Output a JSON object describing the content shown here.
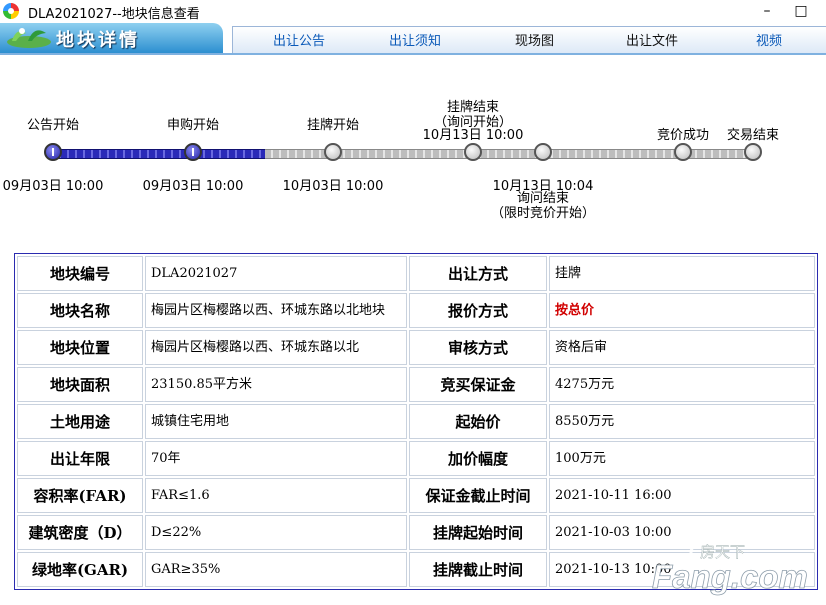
{
  "window": {
    "title": "DLA2021027--地块信息查看",
    "minimize": "–",
    "maximize": "□"
  },
  "logo": {
    "text": "地块详情"
  },
  "nav": [
    "出让公告",
    "出让须知",
    "现场图",
    "出让文件",
    "视频"
  ],
  "timeline": {
    "steps": [
      {
        "label": "公告开始",
        "time": "09月03日 10:00"
      },
      {
        "label": "申购开始",
        "time": "09月03日 10:00"
      },
      {
        "label": "挂牌开始",
        "time": "10月03日 10:00"
      },
      {
        "label": "挂牌结束",
        "sub": "（询问开始）",
        "time": "10月13日 10:00"
      },
      {
        "label": "询问结束",
        "sub": "（限时竞价开始）",
        "time": "10月13日 10:04"
      },
      {
        "label": "竞价成功"
      },
      {
        "label": "交易结束"
      }
    ]
  },
  "table": {
    "rows": [
      [
        "地块编号",
        "DLA2021027",
        "出让方式",
        "挂牌"
      ],
      [
        "地块名称",
        "梅园片区梅樱路以西、环城东路以北地块",
        "报价方式",
        "按总价"
      ],
      [
        "地块位置",
        "梅园片区梅樱路以西、环城东路以北",
        "审核方式",
        "资格后审"
      ],
      [
        "地块面积",
        "23150.85平方米",
        "竞买保证金",
        "4275万元"
      ],
      [
        "土地用途",
        "城镇住宅用地",
        "起始价",
        "8550万元"
      ],
      [
        "出让年限",
        "70年",
        "加价幅度",
        "100万元"
      ],
      [
        "容积率(FAR)",
        "FAR≤1.6",
        "保证金截止时间",
        "2021-10-11 16:00"
      ],
      [
        "建筑密度（D）",
        "D≤22%",
        "挂牌起始时间",
        "2021-10-03 10:00"
      ],
      [
        "绿地率(GAR)",
        "GAR≥35%",
        "挂牌截止时间",
        "2021-10-13 10:00"
      ]
    ]
  },
  "watermark": {
    "brand": "Fang.com",
    "cn": "房天下"
  },
  "colors": {
    "progress_done": "#2a2ab8",
    "accent_link": "#0a59b8",
    "price_red": "#d10000"
  }
}
